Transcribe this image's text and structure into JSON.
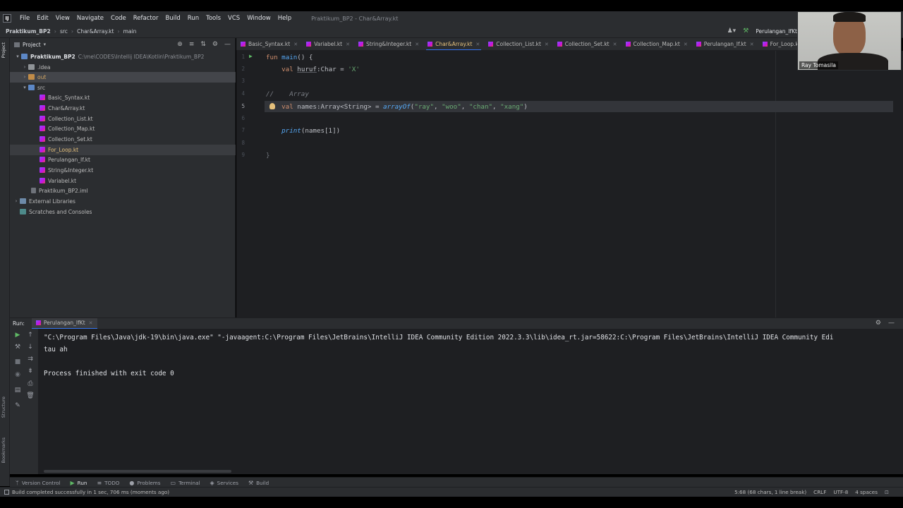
{
  "menubar": {
    "logo": "IJ",
    "items": [
      "File",
      "Edit",
      "View",
      "Navigate",
      "Code",
      "Refactor",
      "Build",
      "Run",
      "Tools",
      "VCS",
      "Window",
      "Help"
    ],
    "title": "Praktikum_BP2 - Char&Array.kt"
  },
  "navbar": {
    "crumbs": [
      "Praktikum_BP2",
      "src",
      "Char&Array.kt",
      "main"
    ],
    "run_config": "Perulangan_IfKt"
  },
  "project": {
    "header": "Project",
    "tree": [
      {
        "label": "Praktikum_BP2",
        "extra": "C:\\me\\CODES\\Intellij IDEA\\Kotlin\\Praktikum_BP2"
      },
      {
        "label": ".idea"
      },
      {
        "label": "out"
      },
      {
        "label": "src"
      },
      {
        "label": "Basic_Syntax.kt"
      },
      {
        "label": "Char&Array.kt"
      },
      {
        "label": "Collection_List.kt"
      },
      {
        "label": "Collection_Map.kt"
      },
      {
        "label": "Collection_Set.kt"
      },
      {
        "label": "For_Loop.kt"
      },
      {
        "label": "Perulangan_If.kt"
      },
      {
        "label": "String&Integer.kt"
      },
      {
        "label": "Variabel.kt"
      },
      {
        "label": "Praktikum_BP2.iml"
      },
      {
        "label": "External Libraries"
      },
      {
        "label": "Scratches and Consoles"
      }
    ]
  },
  "tabs": [
    "Basic_Syntax.kt",
    "Variabel.kt",
    "String&Integer.kt",
    "Char&Array.kt",
    "Collection_List.kt",
    "Collection_Set.kt",
    "Collection_Map.kt",
    "Perulangan_If.kt",
    "For_Loop.kt"
  ],
  "editor": {
    "line_numbers": [
      "1",
      "2",
      "3",
      "4",
      "5",
      "6",
      "7",
      "8",
      "9"
    ],
    "code": {
      "l1_kw": "fun",
      "l1_fn": "main",
      "l1_rest": "() {",
      "l2_kw": "val",
      "l2_name": "huruf",
      "l2_type": ":Char",
      "l2_eq": " = ",
      "l2_val": "'X'",
      "l4_cmt": "//    Array",
      "l5_kw": "val",
      "l5_name": "names",
      "l5_type": ":Array<String>",
      "l5_eq": " = ",
      "l5_fn": "arrayOf",
      "l5_open": "(",
      "l5_s1": "\"ray\"",
      "l5_c1": ", ",
      "l5_s2": "\"woo\"",
      "l5_c2": ", ",
      "l5_s3": "\"chan\"",
      "l5_c3": ", ",
      "l5_s4": "\"xang\"",
      "l5_close": ")",
      "l7_fn": "print",
      "l7_rest": "(names[1])",
      "l9_brace": "}"
    }
  },
  "webcam": {
    "name": "Ray Tomasila"
  },
  "run": {
    "label": "Run:",
    "tab": "Perulangan_IfKt",
    "console": [
      "\"C:\\Program Files\\Java\\jdk-19\\bin\\java.exe\" \"-javaagent:C:\\Program Files\\JetBrains\\IntelliJ IDEA Community Edition 2022.3.3\\lib\\idea_rt.jar=58622:C:\\Program Files\\JetBrains\\IntelliJ IDEA Community Edi",
      "tau ah",
      "",
      "Process finished with exit code 0"
    ]
  },
  "bottom_tools": [
    "Version Control",
    "Run",
    "TODO",
    "Problems",
    "Terminal",
    "Services",
    "Build"
  ],
  "status": {
    "message": "Build completed successfully in 1 sec, 706 ms (moments ago)",
    "position": "5:68 (68 chars, 1 line break)",
    "line_sep": "CRLF",
    "encoding": "UTF-8",
    "indent": "4 spaces"
  },
  "left_strip": {
    "project": "Project",
    "structure": "Structure",
    "bookmarks": "Bookmarks"
  }
}
